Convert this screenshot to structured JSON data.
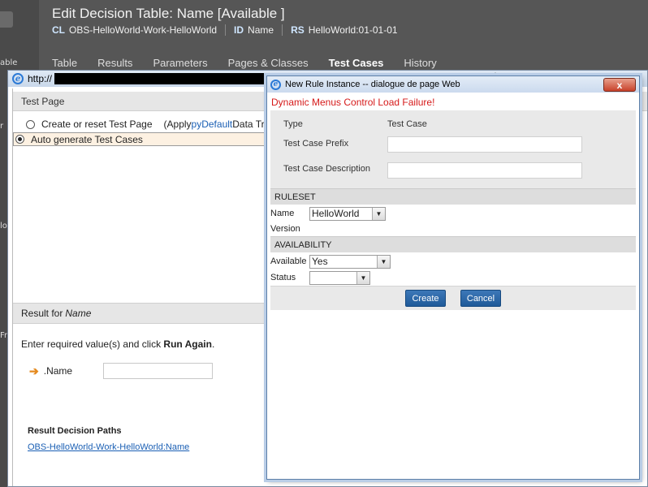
{
  "background": {
    "left_fragments": [
      "able",
      "r",
      "lo",
      "Fre"
    ],
    "title": "Edit Decision Table: Name [Available ]",
    "meta": [
      {
        "key": "CL",
        "value": "OBS-HelloWorld-Work-HelloWorld"
      },
      {
        "key": "ID",
        "value": "Name"
      },
      {
        "key": "RS",
        "value": "HelloWorld:01-01-01"
      }
    ],
    "tabs": [
      "Table",
      "Results",
      "Parameters",
      "Pages & Classes",
      "Test Cases",
      "History"
    ],
    "active_tab": "Test Cases",
    "ie_fragment": "Internet Explorer"
  },
  "popup": {
    "url_prefix": "http://",
    "test_page": {
      "header": "Test Page",
      "option_reset": "Create or reset Test Page",
      "apply_prefix": "(Apply ",
      "apply_link": "pyDefault",
      "apply_suffix": " Data Transf",
      "option_auto": "Auto generate Test Cases"
    },
    "result": {
      "header_prefix": "Result for",
      "header_name": "Name",
      "instruction_prefix": "Enter required value(s) and click ",
      "instruction_bold": "Run Again",
      "instruction_suffix": ".",
      "field_label": ".Name",
      "field_value": "",
      "paths_heading": "Result Decision Paths",
      "path_link": "OBS-HelloWorld-Work-HelloWorld:Name"
    }
  },
  "dialog": {
    "title": "New Rule Instance -- dialogue de page Web",
    "close_label": "x",
    "error": "Dynamic Menus Control Load Failure!",
    "type_label": "Type",
    "type_value": "Test Case",
    "prefix_label": "Test Case Prefix",
    "prefix_value": "",
    "description_label": "Test Case Description",
    "description_value": "",
    "ruleset_header": "RULESET",
    "name_label": "Name",
    "name_value": "HelloWorld",
    "version_label": "Version",
    "availability_header": "AVAILABILITY",
    "available_label": "Available",
    "available_value": "Yes",
    "status_label": "Status",
    "status_value": "",
    "create_label": "Create",
    "cancel_label": "Cancel"
  }
}
